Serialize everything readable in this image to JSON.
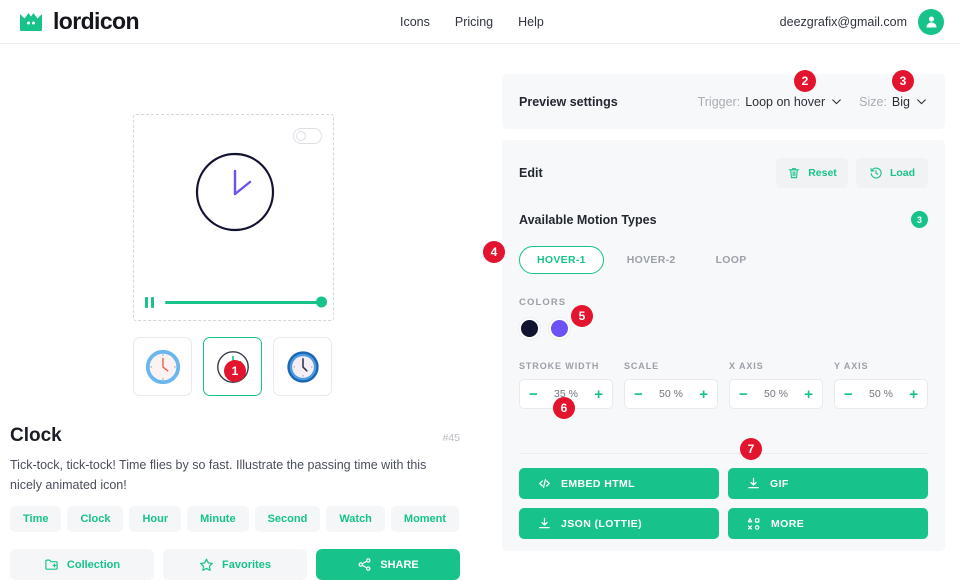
{
  "header": {
    "logo_text": "lordicon",
    "logo_icon": "crown-icon",
    "nav": [
      {
        "label": "Icons",
        "name": "nav-icons"
      },
      {
        "label": "Pricing",
        "name": "nav-pricing"
      },
      {
        "label": "Help",
        "name": "nav-help"
      }
    ],
    "account_email": "deezgrafix@gmail.com",
    "avatar_icon": "user-icon"
  },
  "preview": {
    "toggle_state": "off",
    "play_state_icon": "pause-icon",
    "progress_percent": 100,
    "icon_name": "clock-icon"
  },
  "thumbnails": [
    {
      "name": "thumb-clock-flat",
      "selected": false
    },
    {
      "name": "thumb-clock-outline",
      "selected": true
    },
    {
      "name": "thumb-clock-filled",
      "selected": false
    }
  ],
  "icon_info": {
    "title": "Clock",
    "id": "#45",
    "description": "Tick-tock, tick-tock! Time flies by so fast. Illustrate the passing time with this nicely animated icon!",
    "tags": [
      "Time",
      "Clock",
      "Hour",
      "Minute",
      "Second",
      "Watch",
      "Moment"
    ]
  },
  "actions": [
    {
      "label": "Collection",
      "icon": "folder-plus-icon",
      "name": "collection-button"
    },
    {
      "label": "Favorites",
      "icon": "star-icon",
      "name": "favorites-button"
    },
    {
      "label": "SHARE",
      "icon": "share-icon",
      "name": "share-button"
    }
  ],
  "preview_settings": {
    "title": "Preview settings",
    "trigger_key": "Trigger:",
    "trigger_value": "Loop on hover",
    "size_key": "Size:",
    "size_value": "Big"
  },
  "edit": {
    "title": "Edit",
    "reset_label": "Reset",
    "reset_icon": "trash-icon",
    "load_label": "Load",
    "load_icon": "history-icon",
    "motion_title": "Available Motion Types",
    "motion_count": "3",
    "motion_tabs": [
      {
        "label": "HOVER-1",
        "active": true
      },
      {
        "label": "HOVER-2",
        "active": false
      },
      {
        "label": "LOOP",
        "active": false
      }
    ],
    "colors_label": "COLORS",
    "colors": [
      "#121331",
      "#6c52f4"
    ],
    "steppers": [
      {
        "label": "STROKE WIDTH",
        "value": "35 %"
      },
      {
        "label": "SCALE",
        "value": "50 %"
      },
      {
        "label": "X AXIS",
        "value": "50 %"
      },
      {
        "label": "Y AXIS",
        "value": "50 %"
      }
    ],
    "exports": [
      {
        "label": "EMBED HTML",
        "icon": "code-icon"
      },
      {
        "label": "GIF",
        "icon": "download-icon"
      },
      {
        "label": "JSON (LOTTIE)",
        "icon": "download-icon"
      },
      {
        "label": "MORE",
        "icon": "shapes-icon"
      }
    ]
  },
  "markers": [
    "1",
    "2",
    "3",
    "4",
    "5",
    "6",
    "7"
  ],
  "theme": {
    "brand_green": "#17c38a",
    "marker_red": "#e3142d",
    "icon_dark": "#121331",
    "icon_purple": "#6c52f4"
  }
}
